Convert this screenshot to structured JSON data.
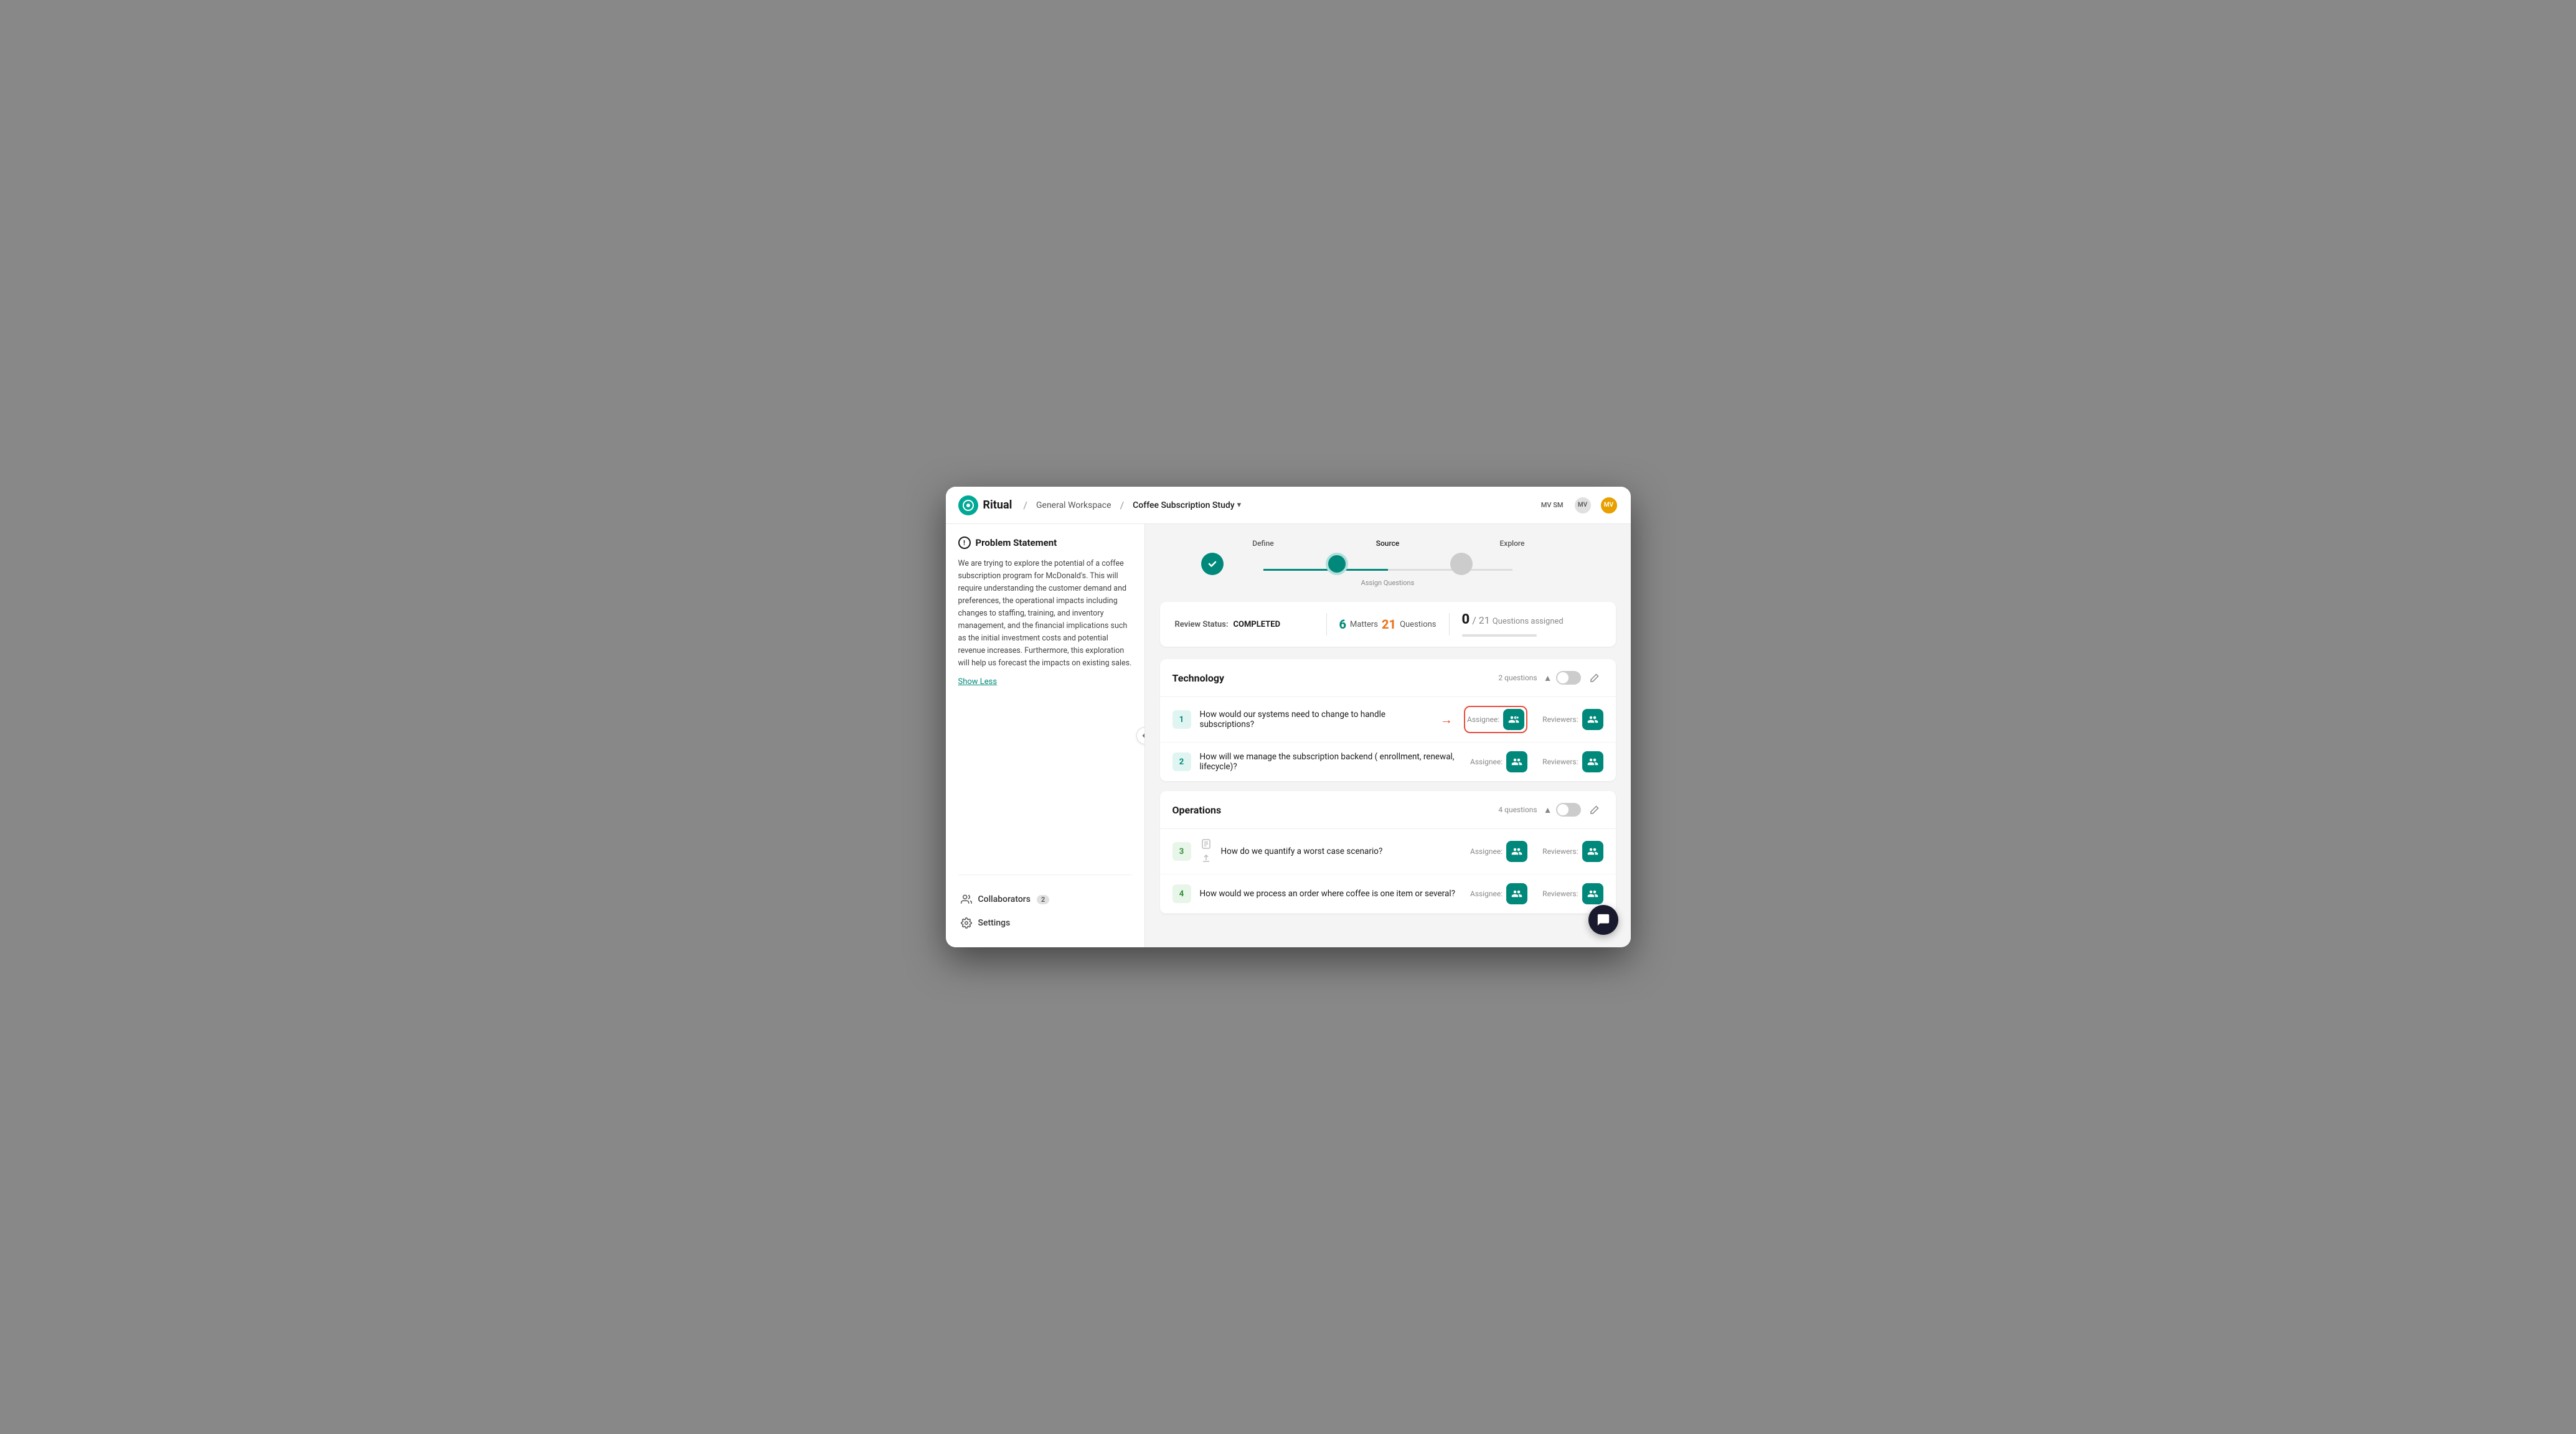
{
  "header": {
    "logo_text": "Ritual",
    "breadcrumb_workspace": "General Workspace",
    "breadcrumb_study": "Coffee Subscription Study",
    "avatar_initials": "MV SM",
    "avatar1": "MV",
    "avatar2": "SM",
    "avatar_active": "MV"
  },
  "sidebar": {
    "problem_statement_title": "Problem Statement",
    "problem_text": "We are trying to explore the potential of a coffee subscription program for McDonald's. This will require understanding the customer demand and preferences, the operational impacts including changes to staffing, training, and inventory management, and the financial implications such as the initial investment costs and potential revenue increases. Furthermore, this exploration will help us forecast the impacts on existing sales.",
    "show_less_label": "Show Less",
    "collaborators_label": "Collaborators",
    "collaborators_count": "2",
    "settings_label": "Settings"
  },
  "progress": {
    "step1_label": "Define",
    "step1_state": "done",
    "step2_label": "Source",
    "step2_state": "current",
    "step2_sublabel": "Assign Questions",
    "step3_label": "Explore",
    "step3_state": "pending"
  },
  "status_bar": {
    "review_label": "Review Status:",
    "review_value": "COMPLETED",
    "matters_count": "6",
    "matters_label": "Matters",
    "questions_count": "21",
    "questions_label": "Questions",
    "assigned_current": "0",
    "assigned_total": "21",
    "assigned_label": "Questions assigned"
  },
  "technology_section": {
    "title": "Technology",
    "questions_count": "2 questions",
    "questions": [
      {
        "number": "1",
        "text": "How would our systems need to change to handle subscriptions?",
        "assignee_label": "Assignee:",
        "reviewers_label": "Reviewers:",
        "highlighted": true
      },
      {
        "number": "2",
        "text": "How will we manage the subscription backend ( enrollment, renewal, lifecycle)?",
        "assignee_label": "Assignee:",
        "reviewers_label": "Reviewers:",
        "highlighted": false
      }
    ]
  },
  "operations_section": {
    "title": "Operations",
    "questions_count": "4 questions",
    "questions": [
      {
        "number": "3",
        "text": "How do we quantify a worst case scenario?",
        "assignee_label": "Assignee:",
        "reviewers_label": "Reviewers:"
      },
      {
        "number": "4",
        "text": "How would we process an order where coffee is one item or several?",
        "assignee_label": "Assignee:",
        "reviewers_label": "Reviewers:"
      }
    ]
  },
  "icons": {
    "chevron_down": "▾",
    "chevron_up": "▲",
    "chevron_right": "›",
    "check": "✓",
    "arrow_right": "→",
    "pencil": "✎"
  }
}
